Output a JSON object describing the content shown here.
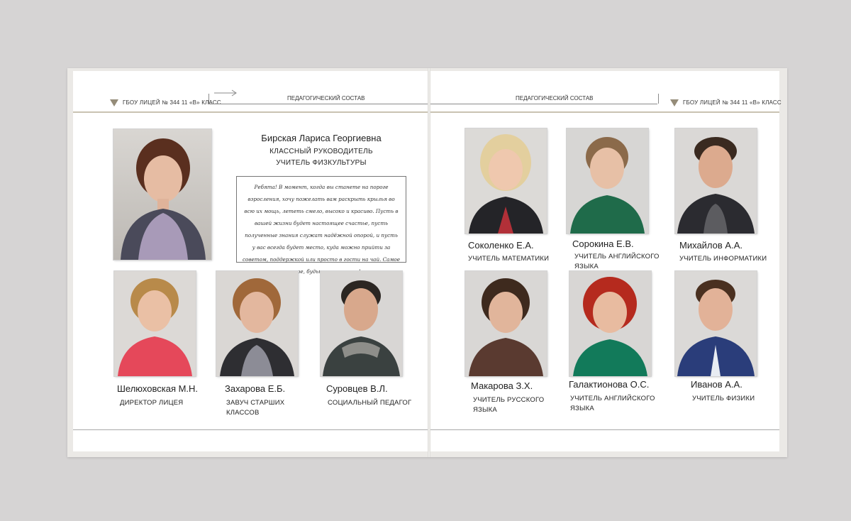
{
  "header": {
    "school": "ГБОУ ЛИЦЕЙ № 344 11 «В» КЛАСС",
    "section_left": "ПЕДАГОГИЧЕСКИЙ СОСТАВ",
    "section_right": "ПЕДАГОГИЧЕСКИЙ СОСТАВ"
  },
  "featured": {
    "name": "Бирская Лариса Георгиевна",
    "role1": "КЛАССНЫЙ РУКОВОДИТЕЛЬ",
    "role2": "УЧИТЕЛЬ ФИЗКУЛЬТУРЫ",
    "quote": "Ребята! В момент, когда вы станете на пороге взросления, хочу пожелать вам раскрыть крылья во всю их мощь, лететь смело, высоко и красиво. Пусть в вашей жизни будет настоящее счастье, пусть полученные знания служат надёжной опорой, и пусть у вас всегда будет место, куда можно прийти за советом, поддержкой или просто в гости на чай. Самое главное, будьте счастливы!"
  },
  "left_teachers": [
    {
      "name": "Шелюховская М.Н.",
      "role": "ДИРЕКТОР ЛИЦЕЯ"
    },
    {
      "name": "Захарова Е.Б.",
      "role": "ЗАВУЧ СТАРШИХ КЛАССОВ"
    },
    {
      "name": "Суровцев В.Л.",
      "role": "СОЦИАЛЬНЫЙ ПЕДАГОГ"
    }
  ],
  "right_teachers_top": [
    {
      "name": "Соколенко Е.А.",
      "role": "УЧИТЕЛЬ МАТЕМАТИКИ"
    },
    {
      "name": "Сорокина Е.В.",
      "role": "УЧИТЕЛЬ АНГЛИЙСКОГО ЯЗЫКА"
    },
    {
      "name": "Михайлов А.А.",
      "role": "УЧИТЕЛЬ ИНФОРМАТИКИ"
    }
  ],
  "right_teachers_bottom": [
    {
      "name": "Макарова З.Х.",
      "role": "УЧИТЕЛЬ РУССКОГО ЯЗЫКА"
    },
    {
      "name": "Галактионова О.С.",
      "role": "УЧИТЕЛЬ АНГЛИЙСКОГО ЯЗЫКА"
    },
    {
      "name": "Иванов А.А.",
      "role": "УЧИТЕЛЬ ФИЗИКИ"
    }
  ],
  "colors": {
    "accent_triangle": "#958c79",
    "rule_gold": "#c9c2b2"
  },
  "icons": [
    "triangle-marker-icon",
    "arrow-right-icon"
  ]
}
